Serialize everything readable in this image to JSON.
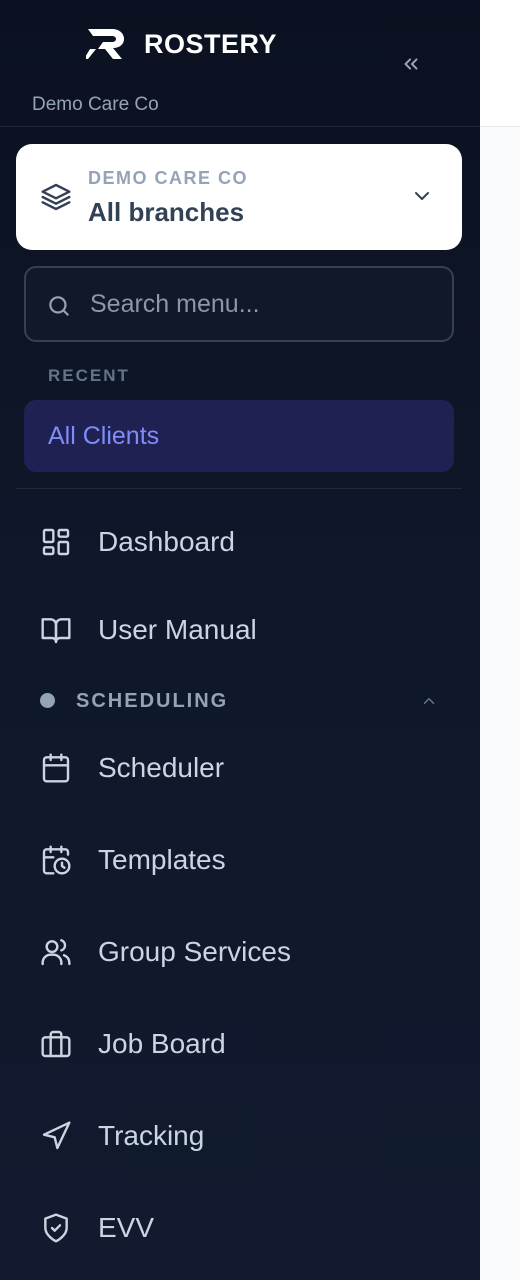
{
  "brand": {
    "name": "ROSTERY",
    "org": "Demo Care Co"
  },
  "branch_selector": {
    "org": "DEMO CARE CO",
    "value": "All branches"
  },
  "search": {
    "placeholder": "Search menu..."
  },
  "recent": {
    "heading": "RECENT",
    "items": [
      {
        "label": "All Clients"
      }
    ]
  },
  "nav": {
    "items": [
      {
        "label": "Dashboard",
        "icon": "dashboard-icon"
      },
      {
        "label": "User Manual",
        "icon": "book-icon"
      }
    ]
  },
  "scheduling": {
    "heading": "SCHEDULING",
    "expanded": true,
    "items": [
      {
        "label": "Scheduler",
        "icon": "calendar-icon"
      },
      {
        "label": "Templates",
        "icon": "calendar-clock-icon"
      },
      {
        "label": "Group Services",
        "icon": "users-icon"
      },
      {
        "label": "Job Board",
        "icon": "briefcase-icon"
      },
      {
        "label": "Tracking",
        "icon": "navigation-icon"
      },
      {
        "label": "EVV",
        "icon": "shield-check-icon"
      }
    ]
  },
  "colors": {
    "sidebar_bg": "#0f172a",
    "accent": "#818cf8",
    "active_bg": "#1e2151",
    "text": "#cbd5e1",
    "muted": "#94a3b8"
  }
}
